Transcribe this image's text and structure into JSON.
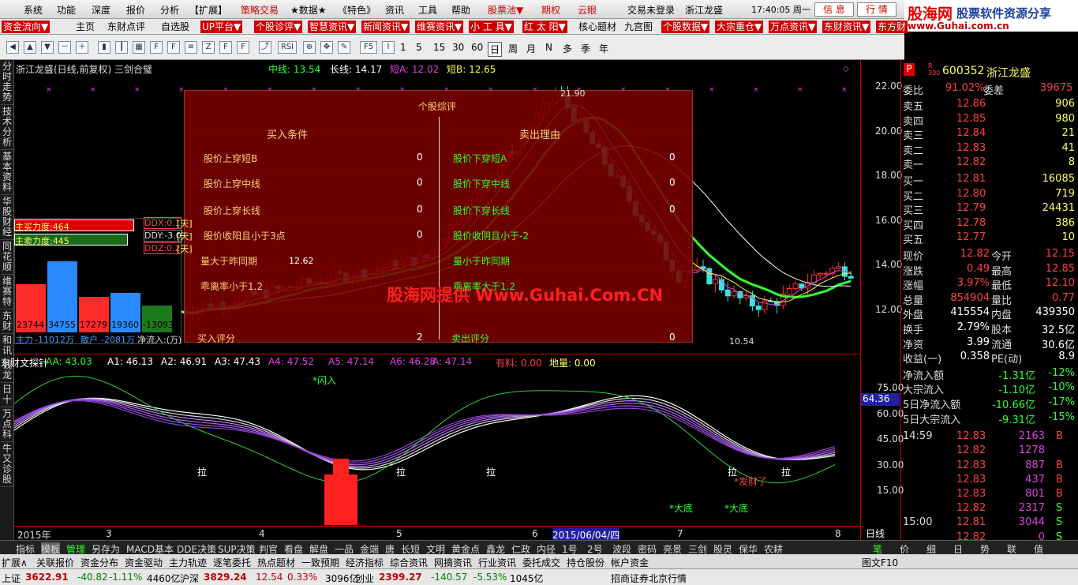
{
  "menu": [
    "系统",
    "功能",
    "深度",
    "报价",
    "分析",
    "【扩展】",
    "策略交易",
    "★数据★",
    "《特色》",
    "资讯",
    "工具",
    "帮助",
    "股票池▼"
  ],
  "menu_right_tabs": [
    "期权",
    "云眼"
  ],
  "login": "交易未登录",
  "stock_header": "浙江龙盛",
  "clock": "17:40:05 周一",
  "menu_btns": [
    "信 息",
    "行 情"
  ],
  "logo": {
    "brand": "股海网",
    "slogan": "股票软件资源分享",
    "url": "www.Guhai.com.cn"
  },
  "toolrow1": [
    "资金流向▼",
    "主页",
    "东财点评",
    "自选股",
    "UP平台▼",
    "个股诊评▼",
    "智慧资讯▼",
    "新闻资讯▼",
    "维赛资讯▼",
    "小 工 具▼",
    "红 太 阳▼",
    "核心题材",
    "九宫图",
    "个股数据▼",
    "大宗重仓▼",
    "万点资讯▼",
    "东财资讯▼",
    "东方财"
  ],
  "periods": [
    "1",
    "5",
    "15",
    "30",
    "60",
    "日",
    "周",
    "月",
    "N",
    "多",
    "季",
    "年"
  ],
  "leftnav": [
    "分时走势",
    "技术分析",
    "基本资料",
    "华股财经",
    "同花顺",
    "维赛特",
    "东财",
    "和讯",
    "钱龙",
    "日十",
    "万点科",
    "牛又诊股"
  ],
  "chart": {
    "title": "浙江龙盛(日线,前复权) 三剑合璧",
    "ma": [
      "中线: 13.54",
      "长线: 14.17",
      "短A: 12.02",
      "短B: 12.65"
    ],
    "high_label": "21.90",
    "low_label": "10.54",
    "mid_label": "12.62",
    "panel": {
      "title": "个股综评",
      "buy_title": "买入条件",
      "sell_title": "卖出理由",
      "buy": [
        [
          "股价上穿短B",
          "0"
        ],
        [
          "股价上穿中线",
          "0"
        ],
        [
          "股价上穿长线",
          "0"
        ],
        [
          "股价收阳且小于3点",
          "0"
        ],
        [
          "量大于昨同期",
          ""
        ],
        [
          "乖离率小于1.2",
          ""
        ]
      ],
      "sell": [
        [
          "股价下穿短A",
          "0"
        ],
        [
          "股价下穿中线",
          "0"
        ],
        [
          "股价下穿长线",
          "0"
        ],
        [
          "股价收阴且小于-2",
          ""
        ],
        [
          "量小于昨同期",
          ""
        ],
        [
          "乖离率大于1.2",
          ""
        ]
      ],
      "buy_score": [
        "买入评分",
        "2"
      ],
      "sell_score": [
        "卖出评分",
        "0"
      ]
    },
    "watermark": "股海网提供 Www.Guhai.Com.CN",
    "flow": {
      "main_in": "主买力度:464",
      "main_out": "主卖力度:445",
      "ddx": [
        "DDX:0.1",
        "DDY:-3.0",
        "DDZ:0.2"
      ],
      "ddx_unit": "[天]",
      "bars": [
        "23744",
        "34755",
        "17279",
        "19360",
        "-13093"
      ],
      "labels": [
        "主力",
        "-11012万",
        "散户",
        "-2081万",
        "净流入:(万)"
      ]
    },
    "price_axis": [
      "22.00",
      "20.00",
      "18.00",
      "16.00",
      "14.00",
      "12.00"
    ]
  },
  "indicator": {
    "name": "东财文探针",
    "vals": [
      "AA: 43.03",
      "A1: 46.13",
      "A2: 46.91",
      "A3: 47.43",
      "A4: 47.52",
      "A5: 47.14",
      "A6: 46.28",
      "A: 47.14"
    ],
    "extra": [
      "有料: 0.00",
      "地量: 0.00"
    ],
    "axis": [
      "75.00",
      "60.00",
      "45.00",
      "30.00",
      "15.00"
    ],
    "cur": "64.36",
    "marks": [
      "拉",
      "拉",
      "拉",
      "拉",
      "拉"
    ],
    "notes": [
      "*闪入",
      "*大底",
      "*大底",
      "*发财了"
    ]
  },
  "dates": [
    "2015年",
    "3",
    "4",
    "5",
    "6",
    "2015/06/04/四",
    "7",
    "8"
  ],
  "quote": {
    "code": "600352",
    "name": "浙江龙盛",
    "wb": [
      "委比",
      "91.02%",
      "委差",
      "39675"
    ],
    "asks": [
      [
        "卖五",
        "12.86",
        "906"
      ],
      [
        "卖四",
        "12.85",
        "980"
      ],
      [
        "卖三",
        "12.84",
        "21"
      ],
      [
        "卖二",
        "12.83",
        "41"
      ],
      [
        "卖一",
        "12.82",
        "8"
      ]
    ],
    "bids": [
      [
        "买一",
        "12.81",
        "16085"
      ],
      [
        "买二",
        "12.80",
        "719"
      ],
      [
        "买三",
        "12.79",
        "24431"
      ],
      [
        "买四",
        "12.78",
        "386"
      ],
      [
        "买五",
        "12.77",
        "10"
      ]
    ],
    "stats": [
      [
        "现价",
        "12.82",
        "今开",
        "12.15"
      ],
      [
        "涨跌",
        "0.49",
        "最高",
        "12.85"
      ],
      [
        "涨幅",
        "3.97%",
        "最低",
        "12.10"
      ],
      [
        "总量",
        "854904",
        "量比",
        "0.77"
      ],
      [
        "外盘",
        "415554",
        "内盘",
        "439350"
      ],
      [
        "换手",
        "2.79%",
        "股本",
        "32.5亿"
      ],
      [
        "净资",
        "3.99",
        "流通",
        "30.6亿"
      ],
      [
        "收益(一)",
        "0.358",
        "PE(动)",
        "8.9"
      ]
    ],
    "flows": [
      [
        "净流入额",
        "-1.31亿",
        "-12%"
      ],
      [
        "大宗流入",
        "-1.10亿",
        "-10%"
      ],
      [
        "5日净流入额",
        "-10.66亿",
        "-17%"
      ],
      [
        "5日大宗流入",
        "-9.31亿",
        "-15%"
      ]
    ],
    "ticks": [
      [
        "14:59",
        "12.83",
        "2163",
        "B"
      ],
      [
        "",
        "12.82",
        "1278",
        ""
      ],
      [
        "",
        "12.83",
        "887",
        "B"
      ],
      [
        "",
        "12.83",
        "437",
        "B"
      ],
      [
        "",
        "12.83",
        "801",
        "B"
      ],
      [
        "",
        "12.82",
        "2317",
        "S"
      ],
      [
        "15:00",
        "12.81",
        "3044",
        "S"
      ],
      [
        "",
        "12.82",
        "0",
        "S"
      ]
    ]
  },
  "bottomtabs": [
    "指标",
    "模板",
    "管理",
    "另存为",
    "MACD基本",
    "DDE决策",
    "SUP决策",
    "判官",
    "看盘",
    "解盘",
    "一品",
    "金端",
    "唐",
    "长短",
    "文明",
    "黄金点",
    "鑫龙",
    "仁政",
    "内径",
    "1号",
    "2号",
    "波段",
    "密码",
    "亮景",
    "三剑",
    "股灵",
    "保华",
    "农耕"
  ],
  "bottom2": [
    "扩展∧",
    "关联报价",
    "资金分布",
    "资金驱动",
    "主力轨迹",
    "逐笔委托",
    "热点题材",
    "一致预期",
    "经济指标",
    "综合资讯",
    "网摘资讯",
    "行业资讯",
    "委托成交",
    "持仓股份",
    "帐户资金"
  ],
  "right_tabs": [
    "笔",
    "价",
    "细",
    "日",
    "势",
    "联",
    "值"
  ],
  "daybtn": "日线",
  "fig": "图文F10",
  "status": {
    "sh": [
      "上证",
      "3622.91",
      "-40.82",
      "-1.11%",
      "4460亿"
    ],
    "sz": [
      "沪深",
      "3829.24",
      "12.54",
      "0.33%",
      "3096亿"
    ],
    "cy": [
      "创业",
      "2399.27",
      "-140.57",
      "-5.53%",
      "1045亿"
    ],
    "broker": "招商证券北京行情"
  },
  "colors": {
    "up": "#ff3030",
    "down": "#20d0d0",
    "green": "#30ff30",
    "panel": "#7a0000"
  }
}
